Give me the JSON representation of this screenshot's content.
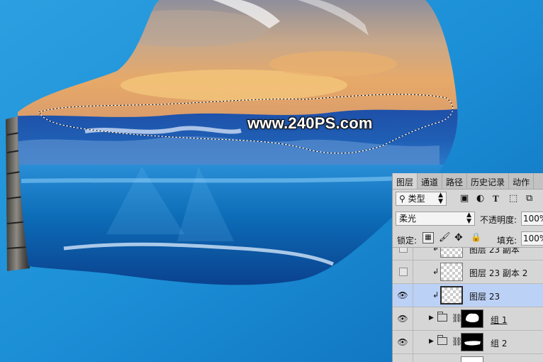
{
  "watermark": "www.240PS.com",
  "panel": {
    "tabs": [
      "图层",
      "通道",
      "路径",
      "历史记录",
      "动作"
    ],
    "filter": {
      "search_icon": "search-icon",
      "kind": "类型"
    },
    "filter_icons": [
      "image-filter-icon",
      "adjustment-filter-icon",
      "type-filter-icon",
      "shape-filter-icon",
      "smart-object-filter-icon"
    ],
    "blend_mode": "柔光",
    "opacity_label": "不透明度:",
    "opacity_value": "100%",
    "lock_label": "锁定:",
    "fill_label": "填充:",
    "fill_value": "100%",
    "layers": [
      {
        "name": "图层 23 副本",
        "visible": false,
        "clipped": true
      },
      {
        "name": "图层 23 副本 2",
        "visible": false,
        "clipped": true
      },
      {
        "name": "图层 23",
        "visible": true,
        "clipped": true,
        "selected": true
      },
      {
        "name": "组 1",
        "visible": true,
        "group": true
      },
      {
        "name": "组 2",
        "visible": true,
        "group": true
      }
    ]
  }
}
